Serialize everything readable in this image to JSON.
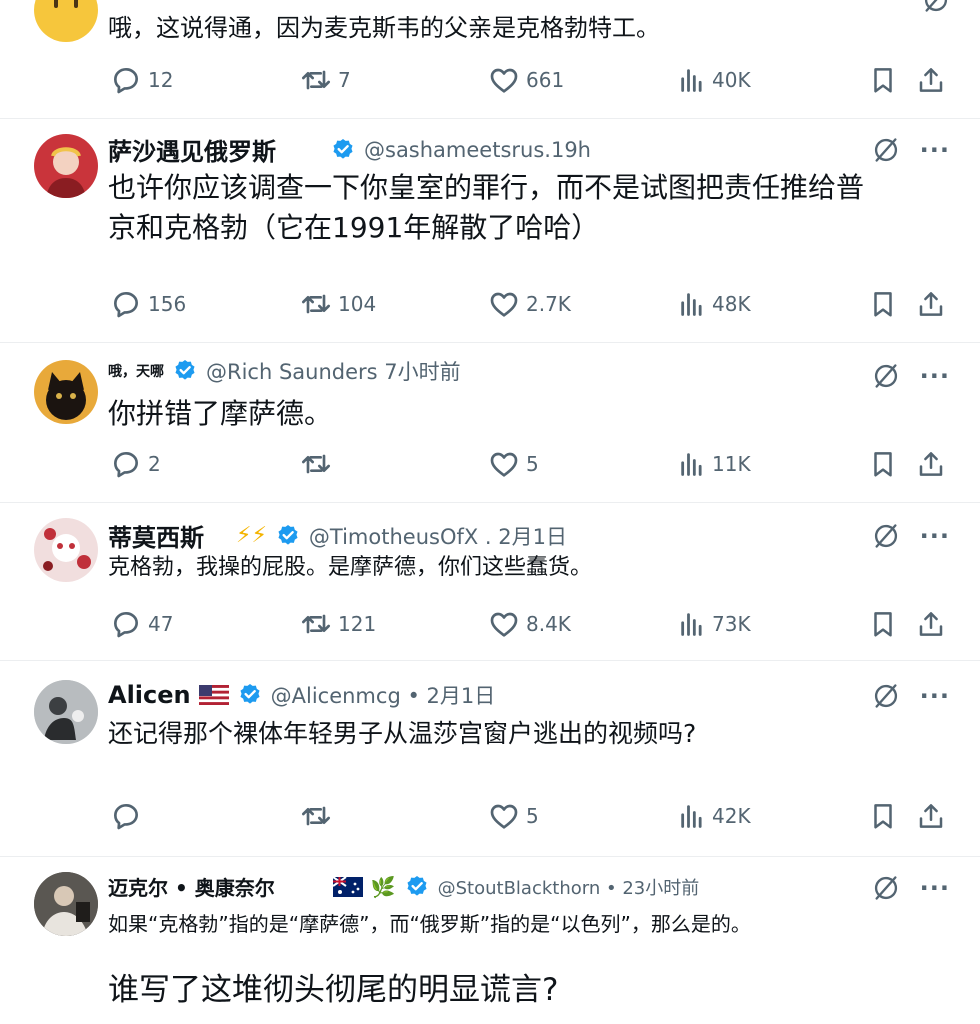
{
  "posts": [
    {
      "name": "",
      "handle": "",
      "text": [
        "哦，这说得通，因为麦克斯韦的父亲是克格勃特工。"
      ],
      "stats": {
        "replies": "12",
        "reposts": "7",
        "likes": "661",
        "views": "40K"
      }
    },
    {
      "name": "萨沙遇见俄罗斯",
      "handle": "@sashameetsrus.19h",
      "text": [
        "也许你应该调查一下你皇室的罪行，而不是试图把责任推给普",
        "京和克格勃（它在1991年解散了哈哈）"
      ],
      "stats": {
        "replies": "156",
        "reposts": "104",
        "likes": "2.7K",
        "views": "48K"
      }
    },
    {
      "name": "哦，天哪",
      "handle": "@Rich Saunders 7小时前",
      "text": [
        "你拼错了摩萨德。"
      ],
      "stats": {
        "replies": "2",
        "reposts": "",
        "likes": "5",
        "views": "11K"
      }
    },
    {
      "name": "蒂莫西斯",
      "handle": "@TimotheusOfX . 2月1日",
      "text": [
        "克格勃，我操的屁股。是摩萨德，你们这些蠢货。"
      ],
      "stats": {
        "replies": "47",
        "reposts": "121",
        "likes": "8.4K",
        "views": "73K"
      }
    },
    {
      "name": "Alicen",
      "handle": "@Alicenmcg • 2月1日",
      "text": [
        "还记得那个裸体年轻男子从温莎宫窗户逃出的视频吗?"
      ],
      "stats": {
        "replies": "",
        "reposts": "",
        "likes": "5",
        "views": "42K"
      }
    },
    {
      "name": "迈克尔 • 奥康奈尔",
      "handle": "@StoutBlackthorn • 23小时前",
      "text": [
        "如果“克格勃”指的是“摩萨德”，而“俄罗斯”指的是“以色列”，那么是的。",
        "谁写了这堆彻头彻尾的明显谎言?"
      ],
      "stats": {}
    }
  ],
  "emoji": {
    "lightning": "⚡⚡",
    "plant": "🌿"
  },
  "colors": {
    "verified": "#1d9bf0",
    "muted": "#536471",
    "text": "#0f1419"
  }
}
